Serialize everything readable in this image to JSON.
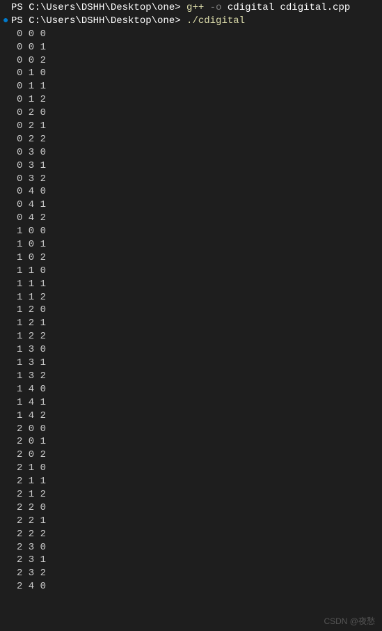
{
  "prompt1": {
    "dot": "",
    "prefix": "PS C:\\Users\\DSHH\\Desktop\\one> ",
    "cmd": "g++",
    "flag": " -o",
    "args": " cdigital cdigital.cpp"
  },
  "prompt2": {
    "dot": "●",
    "prefix": "PS C:\\Users\\DSHH\\Desktop\\one> ",
    "cmd": "./cdigital"
  },
  "output": [
    "0 0 0",
    "0 0 1",
    "0 0 2",
    "0 1 0",
    "0 1 1",
    "0 1 2",
    "0 2 0",
    "0 2 1",
    "0 2 2",
    "0 3 0",
    "0 3 1",
    "0 3 2",
    "0 4 0",
    "0 4 1",
    "0 4 2",
    "1 0 0",
    "1 0 1",
    "1 0 2",
    "1 1 0",
    "1 1 1",
    "1 1 2",
    "1 2 0",
    "1 2 1",
    "1 2 2",
    "1 3 0",
    "1 3 1",
    "1 3 2",
    "1 4 0",
    "1 4 1",
    "1 4 2",
    "2 0 0",
    "2 0 1",
    "2 0 2",
    "2 1 0",
    "2 1 1",
    "2 1 2",
    "2 2 0",
    "2 2 1",
    "2 2 2",
    "2 3 0",
    "2 3 1",
    "2 3 2",
    "2 4 0"
  ],
  "watermark": "CSDN @夜愁"
}
